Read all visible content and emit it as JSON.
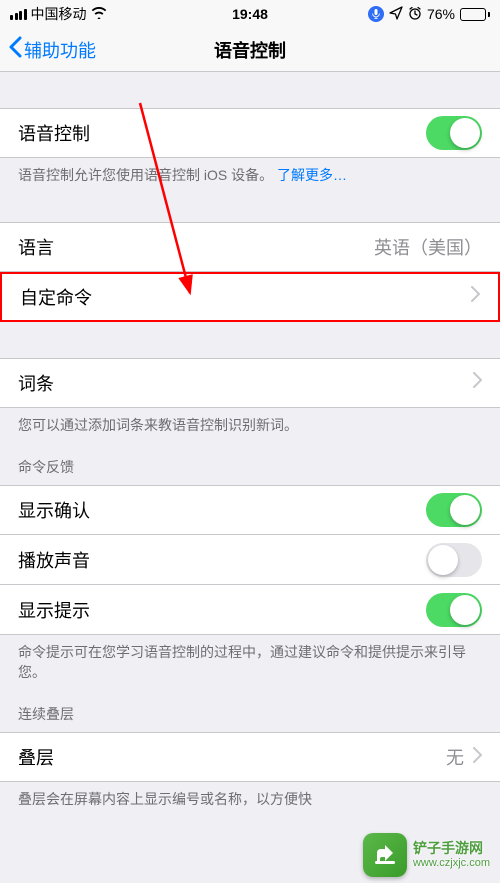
{
  "statusbar": {
    "carrier": "中国移动",
    "time": "19:48",
    "battery_pct": "76%"
  },
  "nav": {
    "back_label": "辅助功能",
    "title": "语音控制"
  },
  "main": {
    "voice_control_label": "语音控制",
    "voice_control_footer": "语音控制允许您使用语音控制 iOS 设备。",
    "learn_more": "了解更多…",
    "language_label": "语言",
    "language_value": "英语（美国）",
    "custom_cmd_label": "自定命令",
    "vocab_label": "词条",
    "vocab_footer": "您可以通过添加词条来教语音控制识别新词。"
  },
  "feedback": {
    "header": "命令反馈",
    "show_confirmation_label": "显示确认",
    "play_sound_label": "播放声音",
    "show_hint_label": "显示提示",
    "footer": "命令提示可在您学习语音控制的过程中，通过建议命令和提供提示来引导您。"
  },
  "overlay": {
    "header": "连续叠层",
    "row_label": "叠层",
    "row_value": "无",
    "footer": "叠层会在屏幕内容上显示编号或名称，以方便快"
  },
  "watermark": {
    "cn": "铲子手游网",
    "url": "www.czjxjc.com"
  }
}
